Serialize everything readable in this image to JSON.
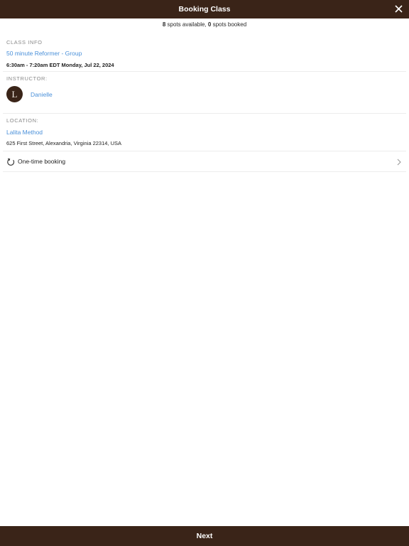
{
  "header": {
    "title": "Booking Class",
    "close_icon": "close-icon"
  },
  "availability": {
    "spots_available_count": "8",
    "spots_available_text": " spots available, ",
    "spots_booked_count": "0",
    "spots_booked_text": " spots booked"
  },
  "class_info": {
    "label": "CLASS INFO",
    "class_name": "50 minute Reformer - Group",
    "datetime": "6:30am - 7:20am EDT Monday, Jul 22, 2024"
  },
  "instructor": {
    "label": "INSTRUCTOR:",
    "avatar_letter": "L",
    "name": "Danielle"
  },
  "location": {
    "label": "LOCATION:",
    "name": "Lalita Method",
    "address": "625 First Street, Alexandria, Virginia 22314, USA"
  },
  "booking_option": {
    "icon": "repeat-icon",
    "label": "One-time booking",
    "chevron_icon": "chevron-right-icon"
  },
  "footer": {
    "next_label": "Next"
  },
  "colors": {
    "brand": "#3a2418",
    "link": "#4a90d9"
  }
}
